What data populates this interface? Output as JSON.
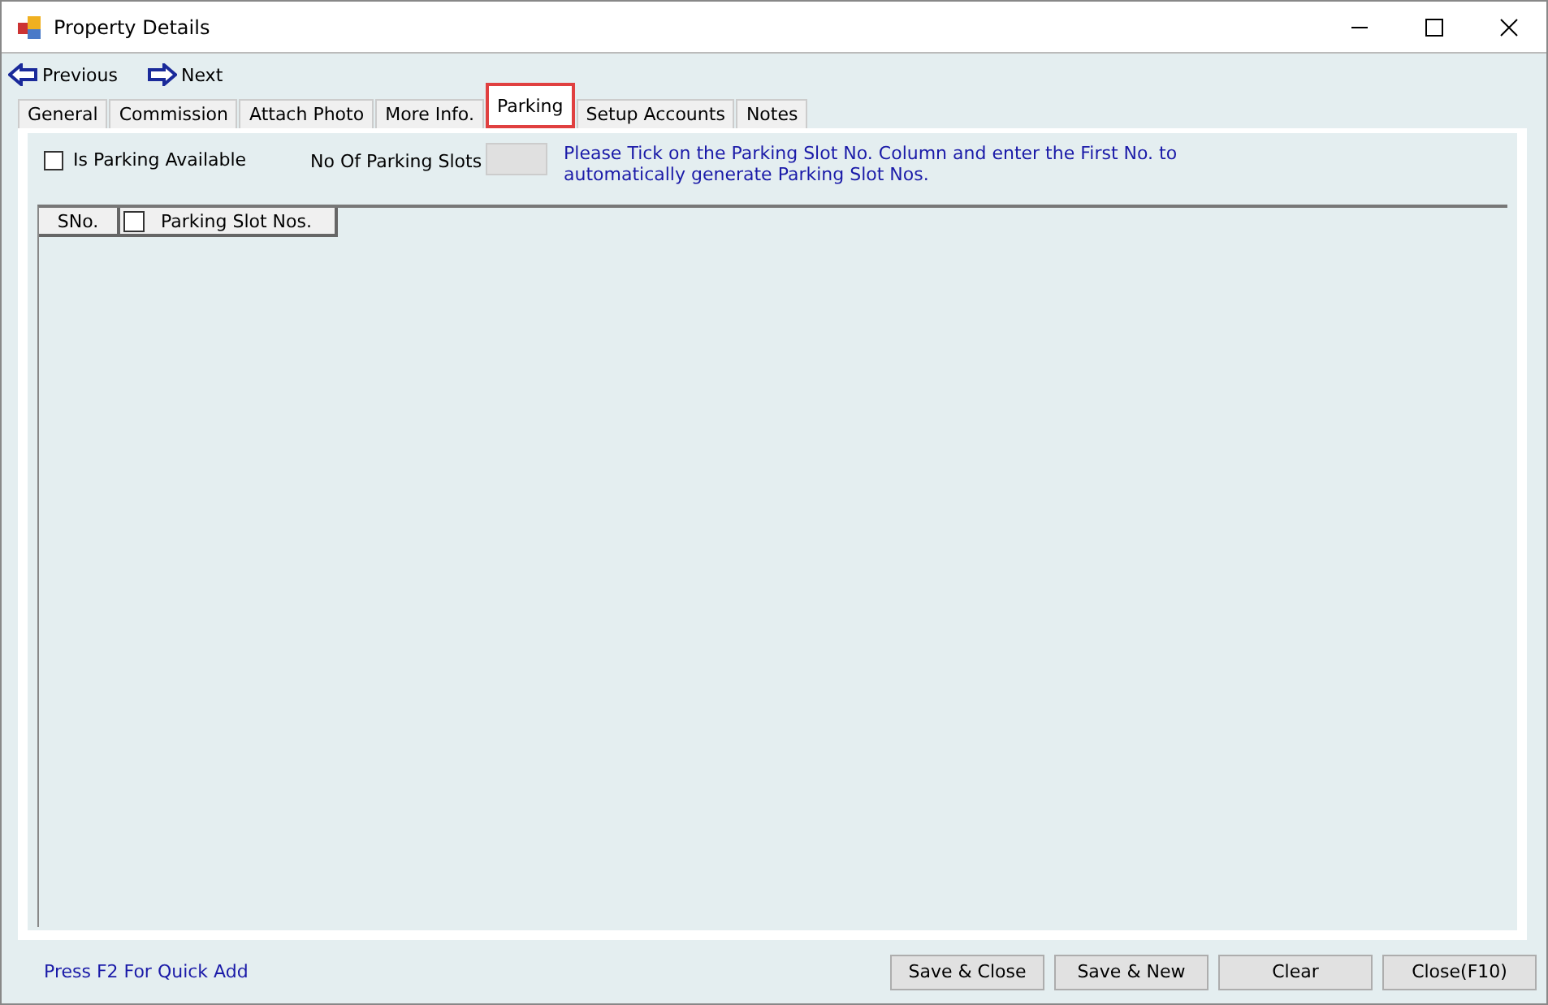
{
  "window": {
    "title": "Property Details"
  },
  "nav": [
    {
      "label": "Previous",
      "kind": "back"
    },
    {
      "label": "Next",
      "kind": "forward"
    }
  ],
  "tabs": [
    {
      "label": "General",
      "selected": false
    },
    {
      "label": "Commission",
      "selected": false
    },
    {
      "label": "Attach Photo",
      "selected": false
    },
    {
      "label": "More Info.",
      "selected": false
    },
    {
      "label": "Parking",
      "selected": true
    },
    {
      "label": "Setup Accounts",
      "selected": false
    },
    {
      "label": "Notes",
      "selected": false
    }
  ],
  "parking": {
    "available": {
      "label": "Is Parking Available",
      "checked": false
    },
    "slots_label": "No Of Parking Slots",
    "hint": "Please Tick on the Parking Slot No. Column and enter the First No. to automatically generate Parking Slot Nos."
  },
  "table": {
    "columns": [
      {
        "label": "SNo."
      },
      {
        "label": "Parking Slot Nos.",
        "checked": false
      }
    ]
  },
  "status_hint": "Press F2 For Quick Add",
  "buttons": [
    "Save & Close",
    "Save & New",
    "Clear",
    "Close(F10)"
  ]
}
